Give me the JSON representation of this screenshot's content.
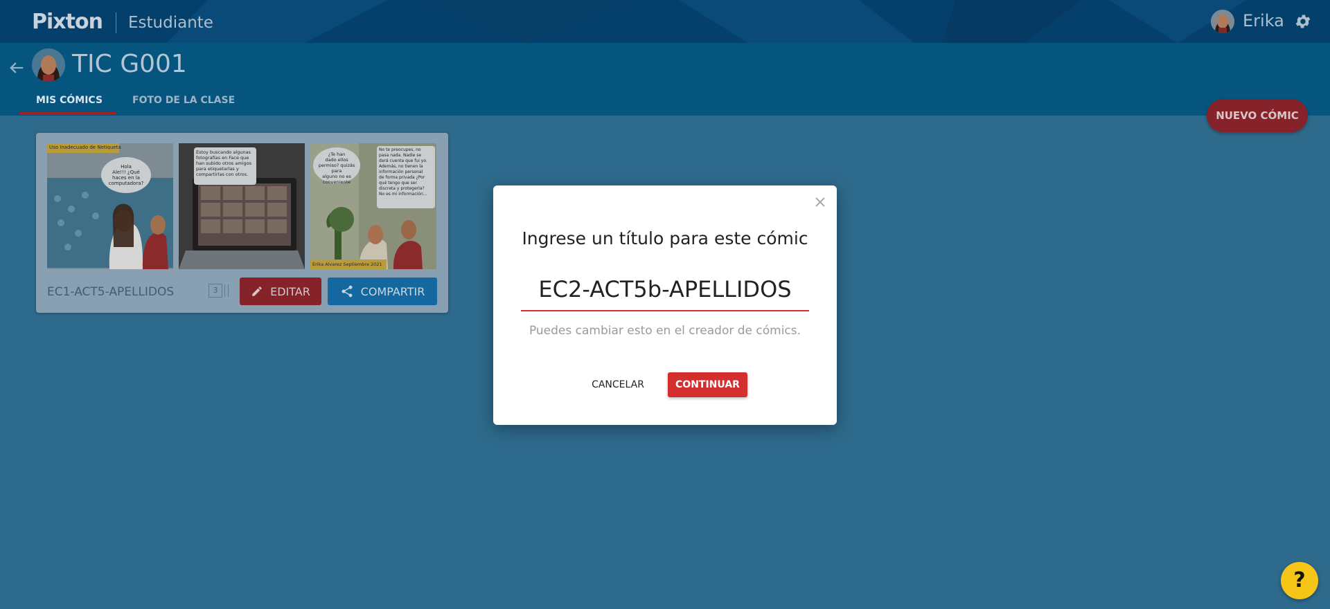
{
  "header": {
    "logo": "Pixton",
    "role": "Estudiante",
    "user_name": "Erika",
    "icons": [
      "back-arrow-icon",
      "settings-gear-icon",
      "help-icon"
    ]
  },
  "class": {
    "title": "TIC G001",
    "tabs": [
      {
        "label": "MIS CÓMICS",
        "active": true
      },
      {
        "label": "FOTO DE LA CLASE",
        "active": false
      }
    ],
    "new_comic_label": "NUEVO CÓMIC"
  },
  "comic_card": {
    "name": "EC1-ACT5-APELLIDOS",
    "panel_count": "3",
    "edit_label": "EDITAR",
    "share_label": "COMPARTIR",
    "panels": [
      {
        "caption_top": "Uso Inadecuado de Netiqueta",
        "bubble": [
          "Hola",
          "Ale!!! ¿Qué",
          "haces en la",
          "computadora?"
        ]
      },
      {
        "bubble": [
          "Estoy buscando algunas",
          "fotografías en Face que",
          "han subido otros amigos",
          "para etiquetarlas y",
          "compartirlas con otros."
        ]
      },
      {
        "bubble_left": [
          "¿Te han",
          "dado ellos",
          "permiso? quizás para",
          "alguno no es",
          "conveniente"
        ],
        "bubble_right": [
          "No te preocupes, no",
          "pasa nada. Nadie se",
          "dará cuenta que fui yo.",
          "Además, no tienen la",
          "información personal",
          "de forma privada ¿Por",
          "qué tengo que ser",
          "discreta y protegerla?",
          "No es mi información..."
        ],
        "caption_bottom": "Erika Alvarez Septiembre 2021"
      }
    ]
  },
  "modal": {
    "heading": "Ingrese un título para este cómic",
    "input_value": "EC2-ACT5b-APELLIDOS",
    "hint": "Puedes cambiar esto en el creador de cómics.",
    "cancel_label": "CANCELAR",
    "continue_label": "CONTINUAR"
  },
  "help_label": "?",
  "colors": {
    "topbar": "#053f6b",
    "classbar": "#05557f",
    "background_dimmed": "#2e6a8c",
    "accent_red": "#d32f2f",
    "accent_blue": "#1567a0",
    "help_yellow": "#f5c518"
  }
}
